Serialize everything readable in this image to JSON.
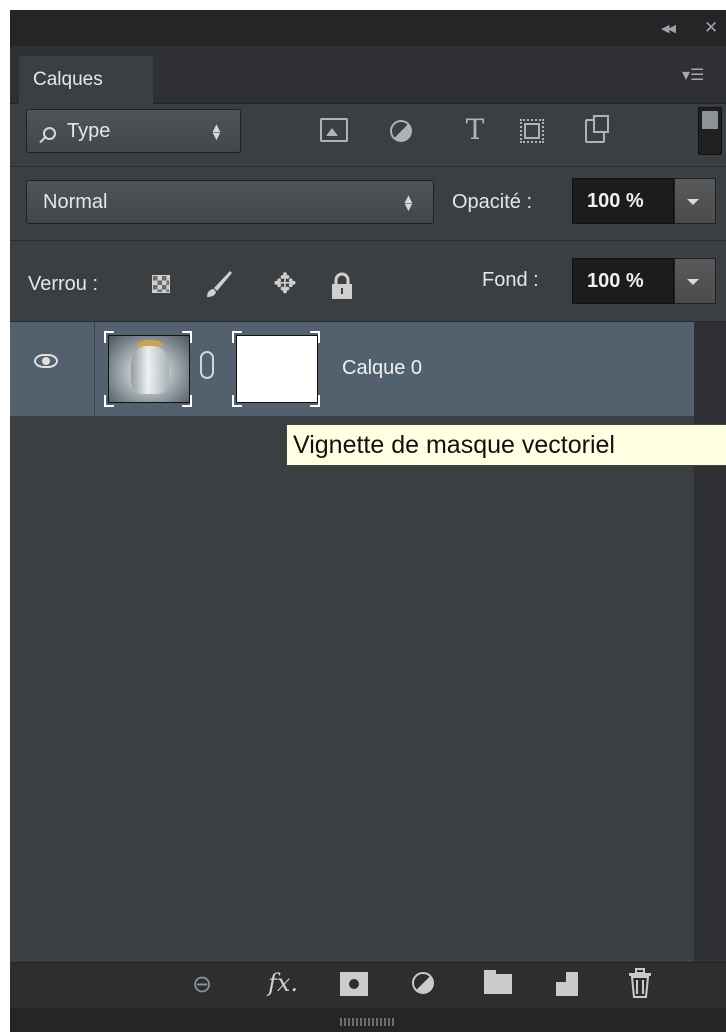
{
  "panel": {
    "tab_label": "Calques",
    "collapse_icon": "double-chevron-left-icon",
    "close_icon": "close-icon",
    "menu_icon": "panel-menu-icon"
  },
  "filter": {
    "kind_label": "Type",
    "icons": [
      "pixel-layer-filter-icon",
      "adjustment-layer-filter-icon",
      "type-layer-filter-icon",
      "shape-layer-filter-icon",
      "smart-object-filter-icon"
    ]
  },
  "blending": {
    "mode": "Normal",
    "opacity_label": "Opacité :",
    "opacity_value": "100 %"
  },
  "lock": {
    "label": "Verrou :",
    "fill_label": "Fond :",
    "fill_value": "100 %",
    "icons": [
      "lock-transparent-pixels-icon",
      "lock-image-pixels-icon",
      "lock-position-icon",
      "lock-all-icon"
    ]
  },
  "layers": [
    {
      "name": "Calque 0",
      "visible": true,
      "selected": true,
      "has_vector_mask": true
    }
  ],
  "tooltip": {
    "text": "Vignette de masque vectoriel"
  },
  "footer_icons": [
    "link-layers-icon",
    "fx-icon",
    "add-mask-icon",
    "new-adjustment-layer-icon",
    "new-group-icon",
    "new-layer-icon",
    "delete-icon"
  ],
  "colors": {
    "panel_bg": "#3c3f42",
    "selected_row": "#53606e",
    "tooltip_bg": "#ffffe1"
  }
}
